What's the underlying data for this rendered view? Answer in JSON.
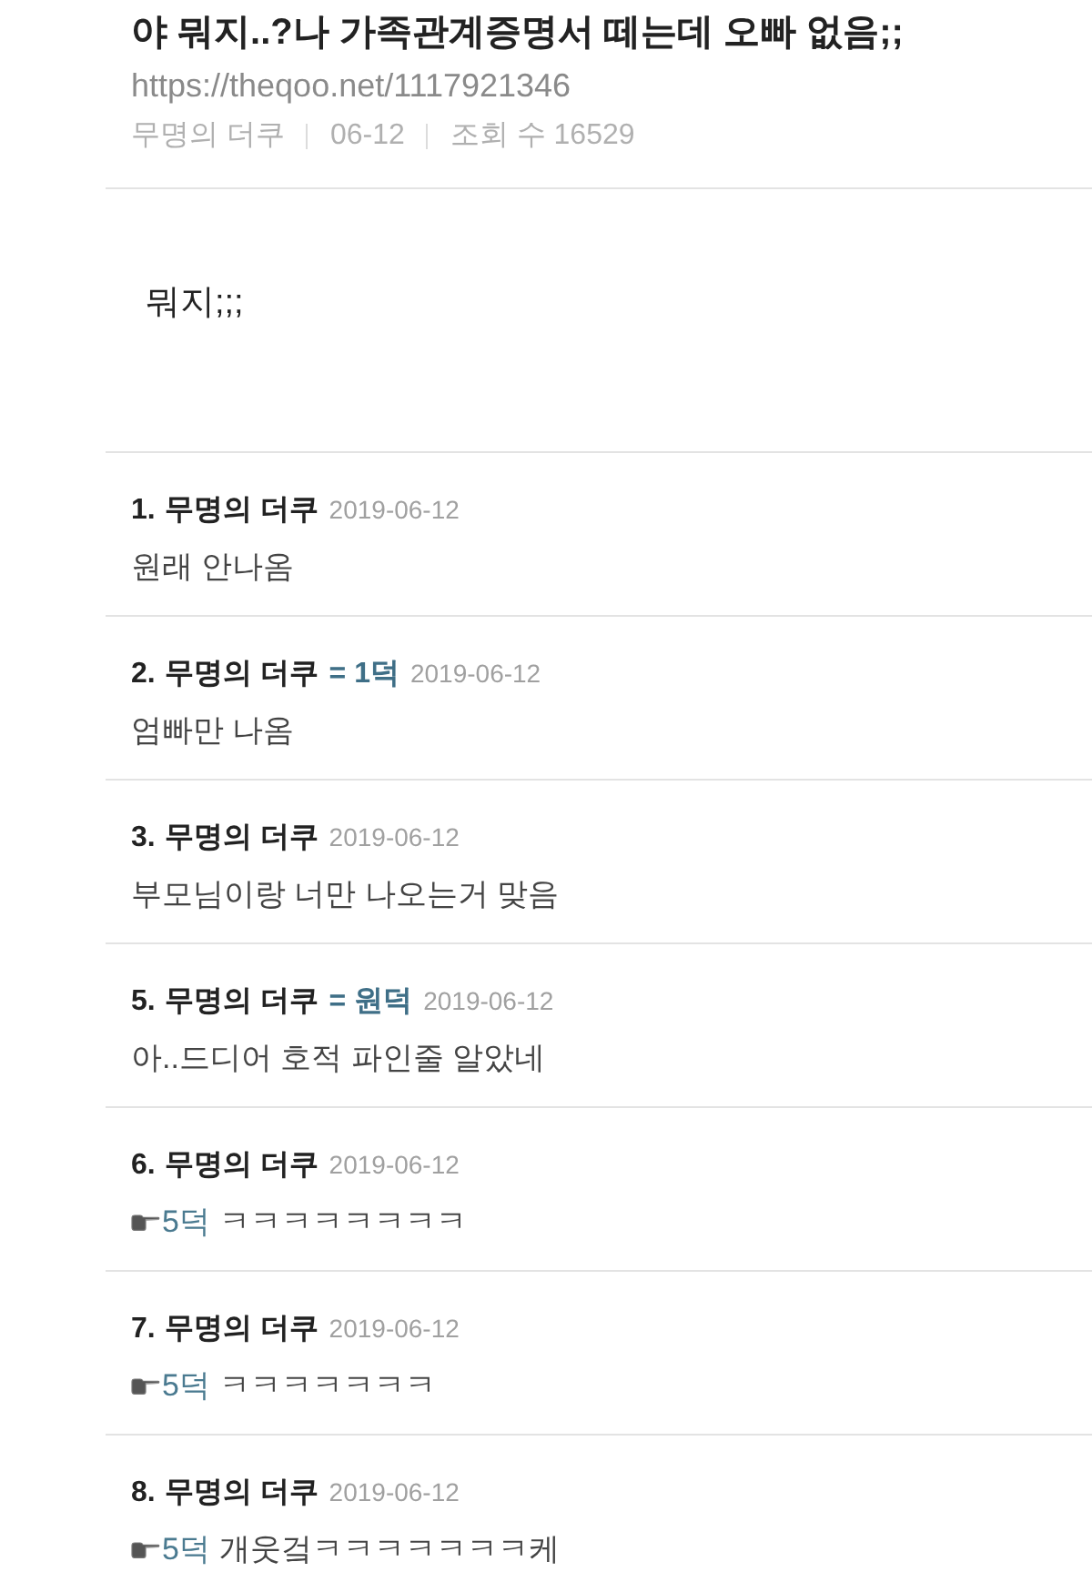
{
  "post": {
    "title": "야 뭐지..?나 가족관계증명서 떼는데 오빠 없음;;",
    "url": "https://theqoo.net/1117921346",
    "meta": [
      "무명의 더쿠",
      "06-12",
      "조회 수 16529"
    ],
    "body": "뭐지;;;"
  },
  "comments": [
    {
      "number": "1.",
      "author": "무명의 더쿠",
      "date": "2019-06-12",
      "text": "원래 안나옴"
    },
    {
      "number": "2.",
      "author": "무명의 더쿠",
      "reply_tag": "= 1덕",
      "date": "2019-06-12",
      "text": "엄빠만 나옴"
    },
    {
      "number": "3.",
      "author": "무명의 더쿠",
      "date": "2019-06-12",
      "text": "부모님이랑 너만 나오는거 맞음"
    },
    {
      "number": "5.",
      "author": "무명의 더쿠",
      "reply_tag": "= 원덕",
      "date": "2019-06-12",
      "text": "아..드디어 호적 파인줄 알았네"
    },
    {
      "number": "6.",
      "author": "무명의 더쿠",
      "date": "2019-06-12",
      "mention": "5덕",
      "text": "ㅋㅋㅋㅋㅋㅋㅋㅋ"
    },
    {
      "number": "7.",
      "author": "무명의 더쿠",
      "date": "2019-06-12",
      "mention": "5덕",
      "text": "ㅋㅋㅋㅋㅋㅋㅋ"
    },
    {
      "number": "8.",
      "author": "무명의 더쿠",
      "date": "2019-06-12",
      "mention": "5덕",
      "text": "개웃겈ㅋㅋㅋㅋㅋㅋㅋ케"
    }
  ]
}
